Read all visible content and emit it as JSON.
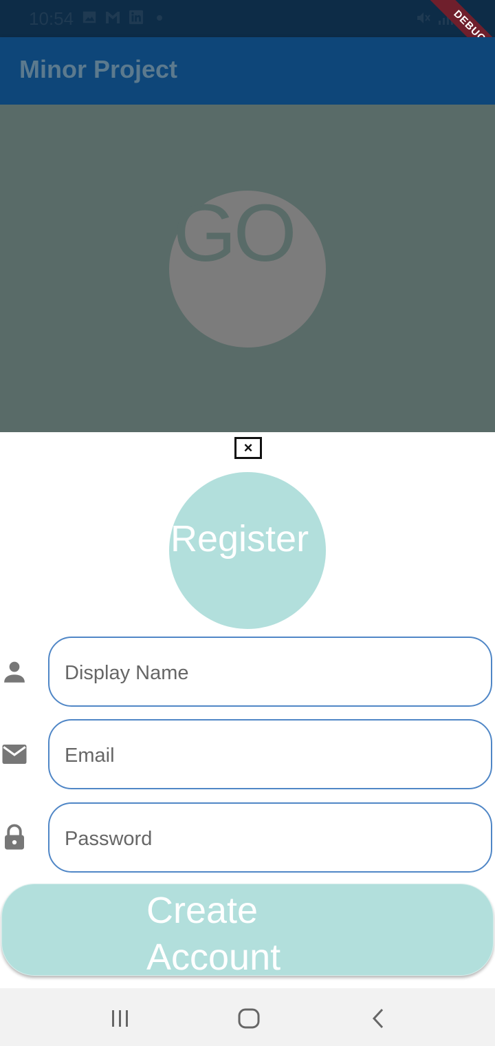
{
  "status_bar": {
    "time": "10:54",
    "left_icons": [
      "image-icon",
      "gmail-icon",
      "linkedin-icon",
      "dot-icon"
    ],
    "right_icons": [
      "mute-icon",
      "signal-icon"
    ],
    "debug_label": "DEBUG"
  },
  "app_bar": {
    "title": "Minor Project"
  },
  "background": {
    "logo_text": "GO"
  },
  "sheet": {
    "close_label": "×",
    "header_text": "Register",
    "fields": [
      {
        "icon": "person-icon",
        "placeholder": "Display Name",
        "value": ""
      },
      {
        "icon": "mail-icon",
        "placeholder": "Email",
        "value": ""
      },
      {
        "icon": "lock-icon",
        "placeholder": "Password",
        "value": ""
      }
    ],
    "create_button_label": "Create Account"
  },
  "colors": {
    "status_bar": "#0d2c47",
    "app_bar": "#0e4679",
    "scrim": "#596b68",
    "accent_teal": "#b2dfdc",
    "field_border": "#4f86c6"
  },
  "nav_bar": {
    "buttons": [
      "recents-icon",
      "home-icon",
      "back-icon"
    ]
  }
}
